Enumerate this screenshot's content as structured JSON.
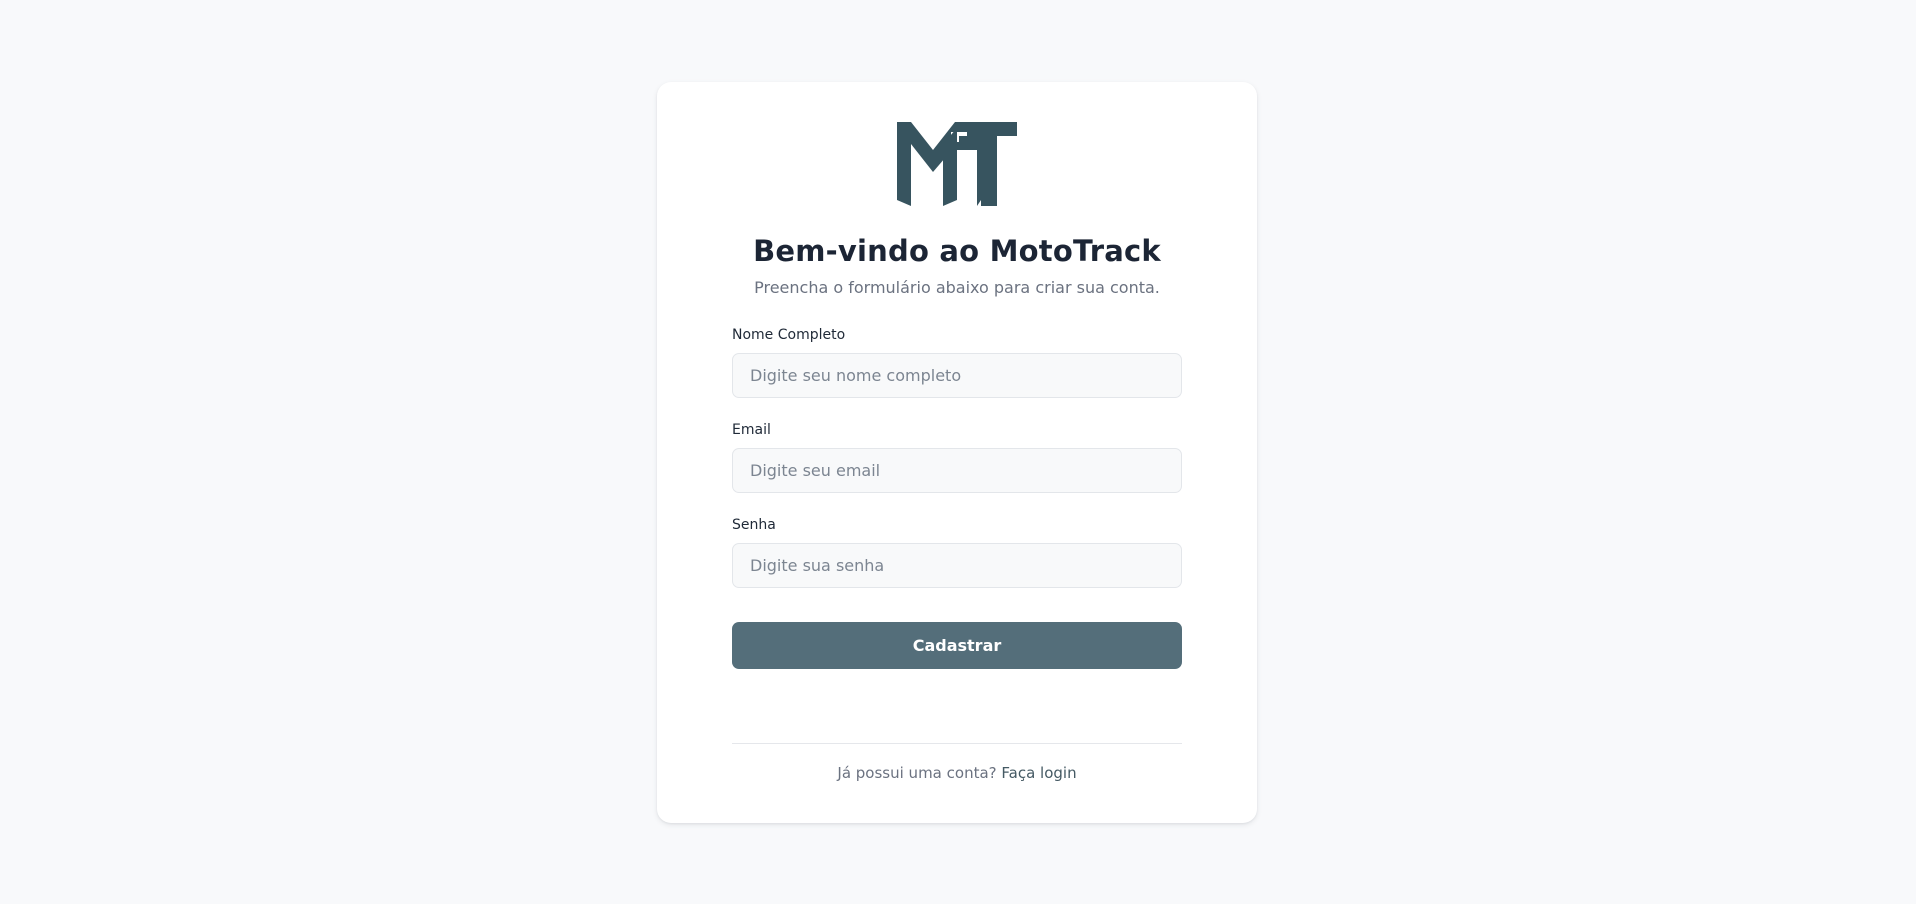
{
  "brand": {
    "logo_text": "MT",
    "logo_color": "#37545f"
  },
  "header": {
    "title": "Bem-vindo ao MotoTrack",
    "subtitle": "Preencha o formulário abaixo para criar sua conta."
  },
  "form": {
    "name": {
      "label": "Nome Completo",
      "placeholder": "Digite seu nome completo",
      "value": ""
    },
    "email": {
      "label": "Email",
      "placeholder": "Digite seu email",
      "value": ""
    },
    "password": {
      "label": "Senha",
      "placeholder": "Digite sua senha",
      "value": ""
    },
    "submit_label": "Cadastrar"
  },
  "footer": {
    "prompt": "Já possui uma conta?",
    "link_label": "Faça login"
  },
  "colors": {
    "background": "#f8f9fb",
    "card": "#ffffff",
    "primary_button": "#546e7a",
    "title_text": "#1c2535",
    "muted_text": "#6b7280"
  }
}
